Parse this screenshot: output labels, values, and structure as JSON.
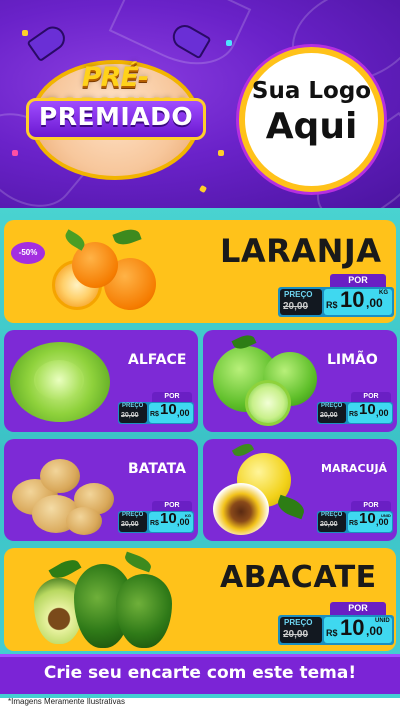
{
  "header": {
    "title_line1": "PRÉ-CARNAVAL",
    "title_line2": "PREMIADO",
    "logo_line1": "Sua Logo",
    "logo_line2": "Aqui"
  },
  "price_labels": {
    "por": "POR",
    "preco": "PREÇO",
    "currency": "R$"
  },
  "products": [
    {
      "name": "LARANJA",
      "discount": "-50%",
      "old_price": "20,00",
      "price_int": "10",
      "price_dec": ",00",
      "unit": "KG"
    },
    {
      "name": "ALFACE",
      "old_price": "20,00",
      "price_int": "10",
      "price_dec": ",00",
      "unit": ""
    },
    {
      "name": "LIMÃO",
      "old_price": "20,00",
      "price_int": "10",
      "price_dec": ",00",
      "unit": ""
    },
    {
      "name": "BATATA",
      "old_price": "20,00",
      "price_int": "10",
      "price_dec": ",00",
      "unit": "KG"
    },
    {
      "name": "MARACUJÁ",
      "old_price": "20,00",
      "price_int": "10",
      "price_dec": ",00",
      "unit": "UNID"
    },
    {
      "name": "ABACATE",
      "old_price": "20,00",
      "price_int": "10",
      "price_dec": ",00",
      "unit": "UNID"
    }
  ],
  "footer": {
    "cta": "Crie seu encarte com este tema!",
    "disclaimer": "*Imagens Meramente Ilustrativas"
  },
  "colors": {
    "header_purple": "#6a22c9",
    "card_yellow": "#ffc21a",
    "card_purple": "#7d2ad6",
    "teal_background": "#45cfd2",
    "price_cyan": "#3fd8f0",
    "price_dark": "#121820"
  },
  "icons": [
    "orange-icon",
    "lettuce-icon",
    "lime-icon",
    "potato-icon",
    "passion-fruit-icon",
    "avocado-icon",
    "party-horn-icon"
  ]
}
